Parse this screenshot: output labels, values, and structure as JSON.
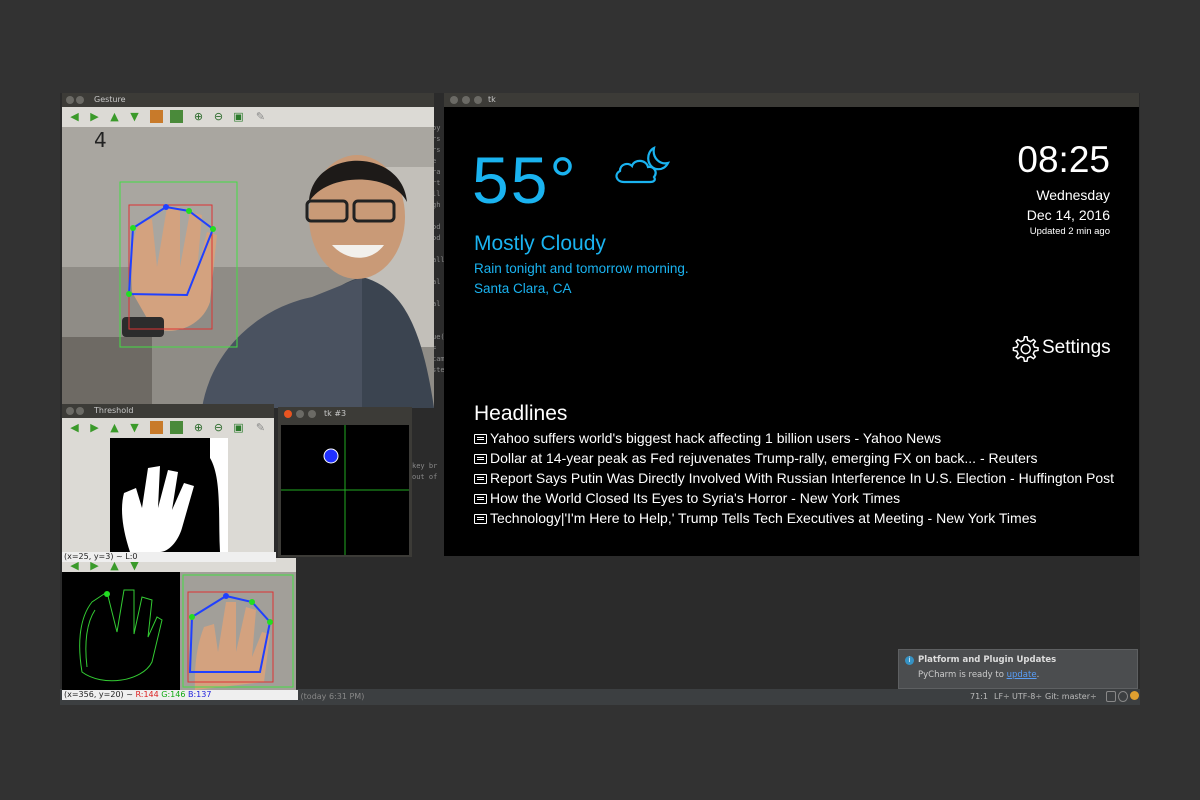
{
  "gesture_window": {
    "title": "Gesture",
    "annotation": "4"
  },
  "threshold_window": {
    "title": "Threshold",
    "status": "(x=25, y=3) ~ L:0"
  },
  "tk3_window": {
    "title": "tk #3"
  },
  "contour_window": {
    "status_prefix": "(x=356, y=20) ~ ",
    "r": "R:144",
    "g": "G:146",
    "b": "B:137"
  },
  "mirror_window": {
    "title": "tk",
    "temperature": "55°",
    "weather_icon": "cloud-moon-icon",
    "condition": "Mostly Cloudy",
    "forecast": "Rain tonight and tomorrow morning.",
    "location": "Santa Clara, CA",
    "time": "08:25",
    "day": "Wednesday",
    "date": "Dec 14, 2016",
    "updated": "Updated 2 min ago",
    "settings_label": "Settings",
    "headlines_title": "Headlines",
    "headlines": [
      "Yahoo suffers world's biggest hack affecting 1 billion users - Yahoo News",
      "Dollar at 14-year peak as Fed rejuvenates Trump-rally, emerging FX on back... - Reuters",
      "Report Says Putin Was Directly Involved With Russian Interference In U.S. Election - Huffington Post",
      "How the World Closed Its Eyes to Syria's Horror - New York Times",
      "Technology|'I'm Here to Help,' Trump Tells Tech Executives at Meeting - New York Times"
    ]
  },
  "notification": {
    "title": "Platform and Plugin Updates",
    "body_prefix": "PyCharm is ready to ",
    "link": "update",
    "body_suffix": "."
  },
  "ide_status": {
    "left": "… (today 6:31 PM)",
    "position": "71:1",
    "line_sep": "LF÷",
    "encoding": "UTF-8÷",
    "git": "Git: master÷"
  },
  "colors": {
    "accent_blue": "#1ab3f0",
    "mirror_bg": "#000000",
    "ide_bg": "#2b2b2b"
  }
}
